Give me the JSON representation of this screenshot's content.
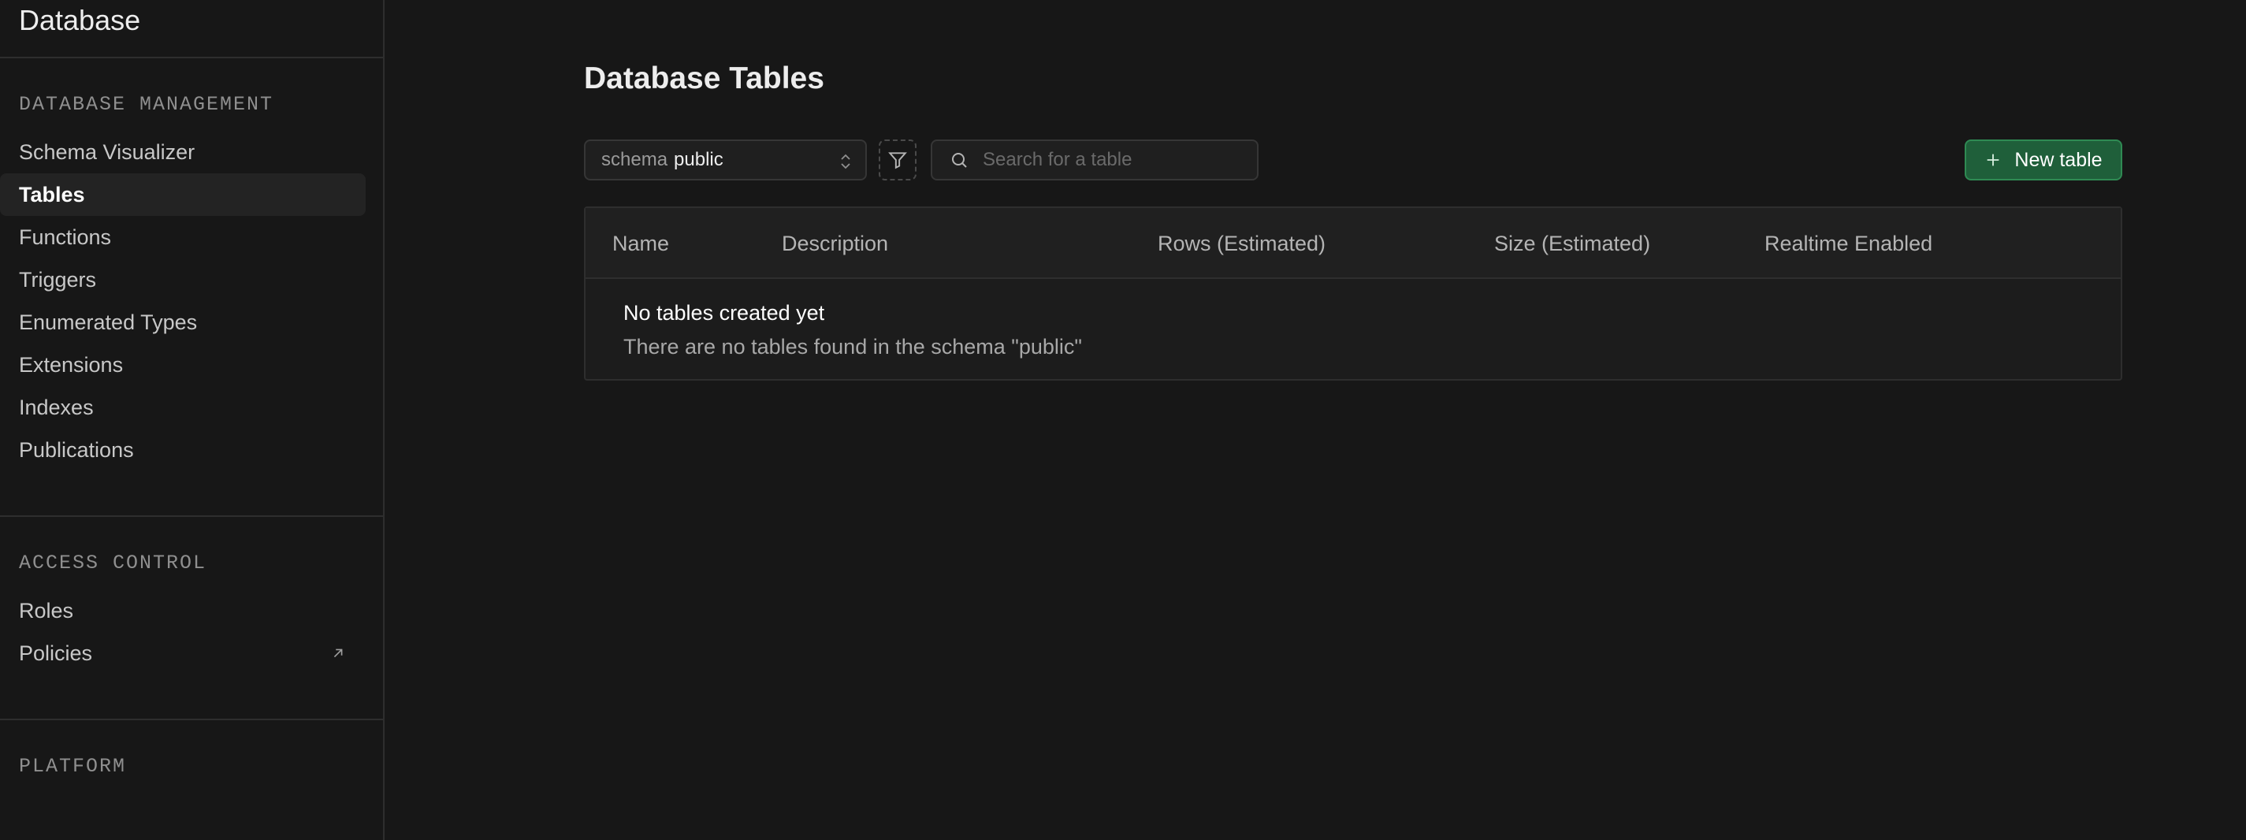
{
  "sidebar": {
    "title": "Database",
    "sections": [
      {
        "title": "DATABASE MANAGEMENT",
        "items": [
          {
            "label": "Schema Visualizer"
          },
          {
            "label": "Tables",
            "active": true
          },
          {
            "label": "Functions"
          },
          {
            "label": "Triggers"
          },
          {
            "label": "Enumerated Types"
          },
          {
            "label": "Extensions"
          },
          {
            "label": "Indexes"
          },
          {
            "label": "Publications"
          }
        ]
      },
      {
        "title": "ACCESS CONTROL",
        "items": [
          {
            "label": "Roles"
          },
          {
            "label": "Policies",
            "icon": "external-link-icon"
          }
        ]
      },
      {
        "title": "PLATFORM",
        "items": []
      }
    ]
  },
  "main": {
    "title": "Database Tables",
    "schema_select": {
      "label": "schema",
      "value": "public"
    },
    "filter_icon": "filter-icon",
    "search": {
      "placeholder": "Search for a table",
      "value": ""
    },
    "new_table_label": "New table",
    "table": {
      "columns": [
        "Name",
        "Description",
        "Rows (Estimated)",
        "Size (Estimated)",
        "Realtime Enabled"
      ],
      "empty_title": "No tables created yet",
      "empty_message": "There are no tables found in the schema \"public\""
    }
  },
  "colors": {
    "background": "#171717",
    "accent_green": "#1f5f3a",
    "border": "#2e2e2e"
  }
}
